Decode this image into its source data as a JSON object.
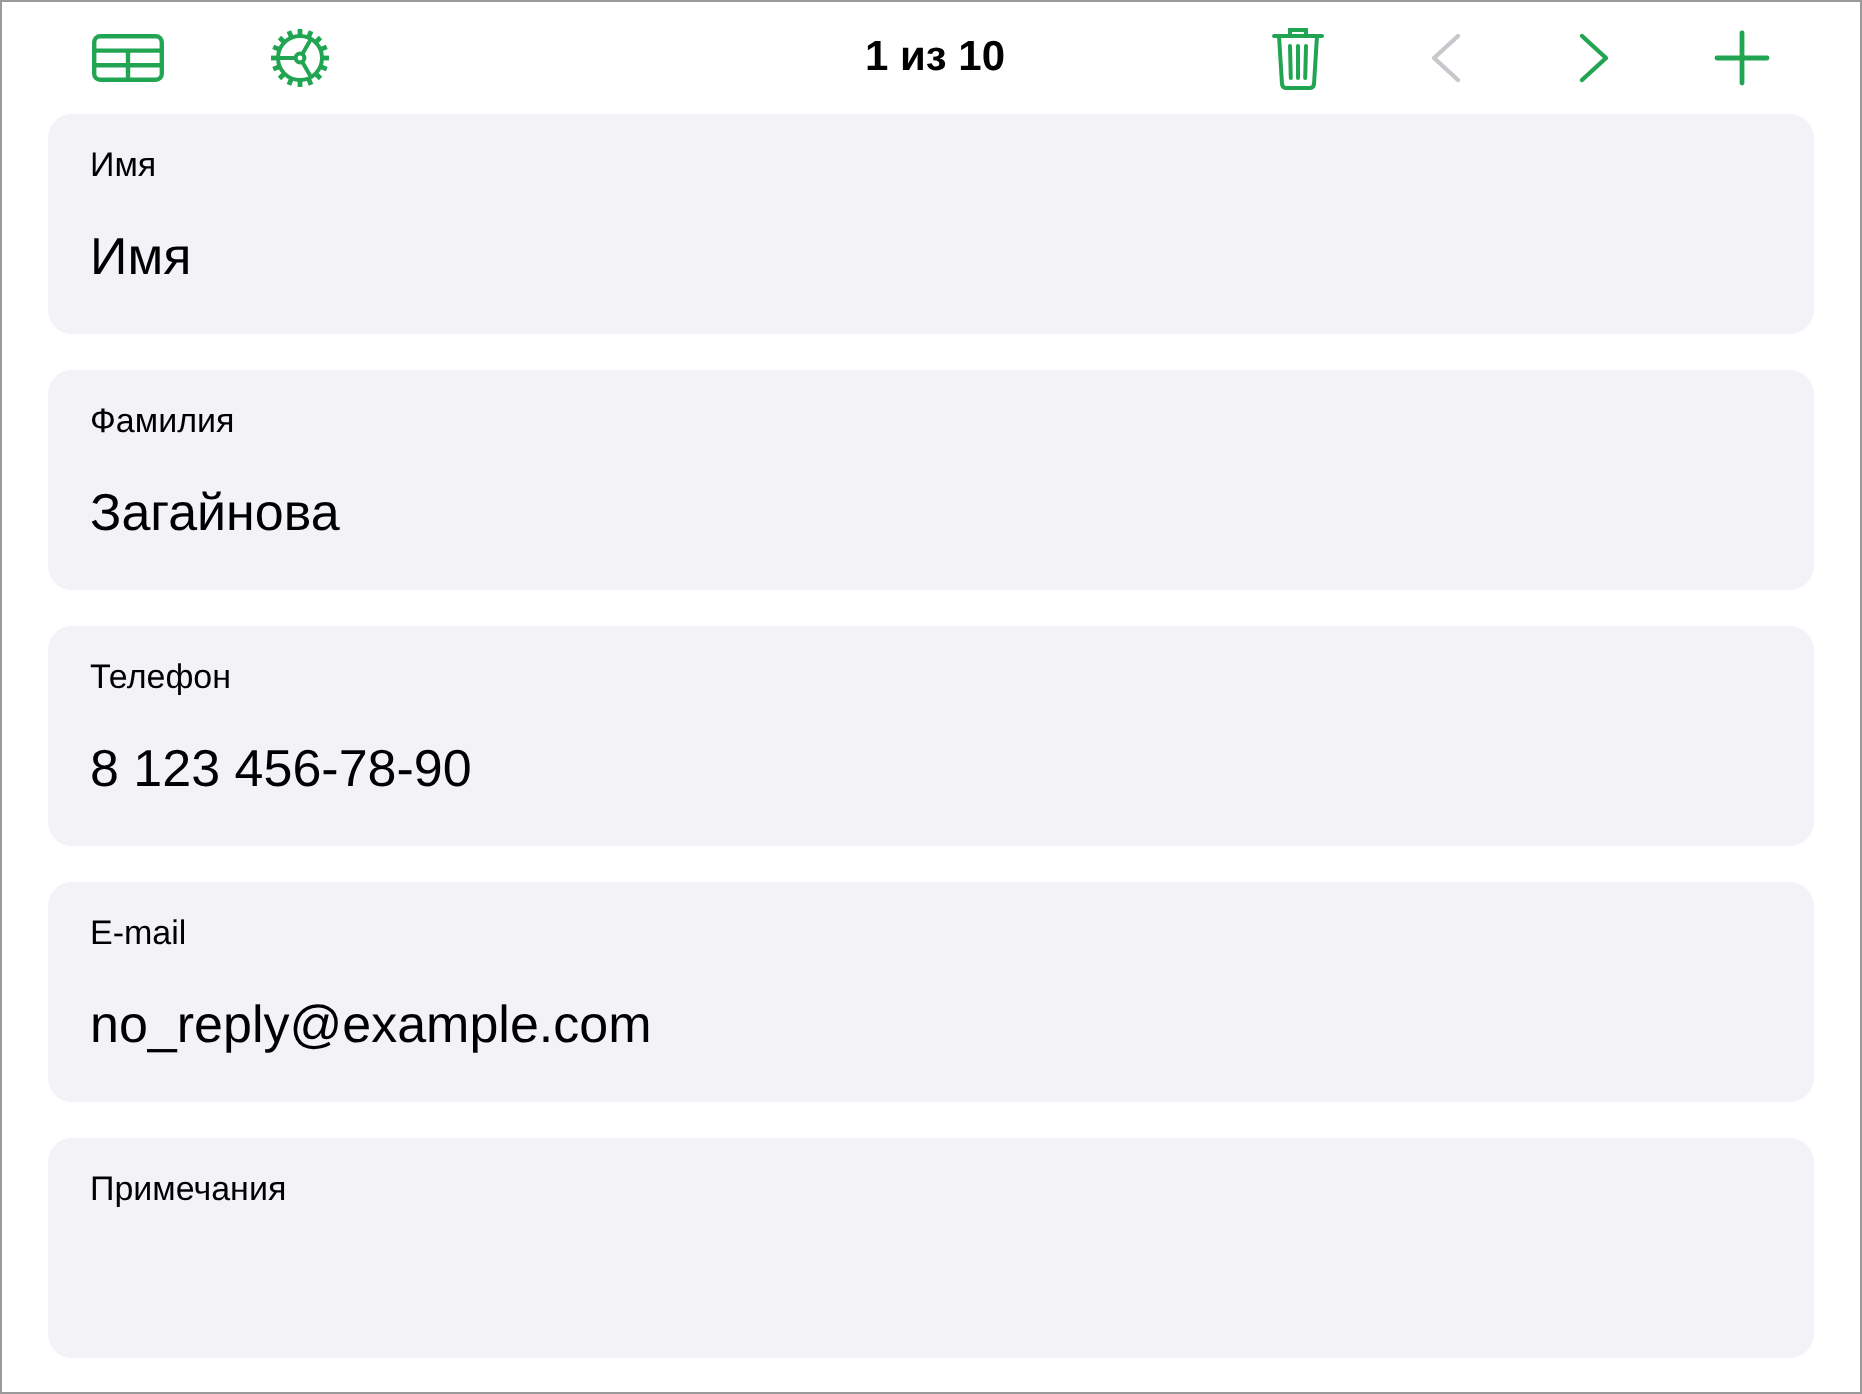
{
  "toolbar": {
    "title": "1 из 10",
    "previous": {
      "disabled": true
    },
    "next": {
      "disabled": false
    }
  },
  "fields": [
    {
      "label": "Имя",
      "value": "Имя"
    },
    {
      "label": "Фамилия",
      "value": "Загайнова"
    },
    {
      "label": "Телефон",
      "value": "8 123 456-78-90"
    },
    {
      "label": "E-mail",
      "value": "no_reply@example.com"
    },
    {
      "label": "Примечания"
    }
  ]
}
